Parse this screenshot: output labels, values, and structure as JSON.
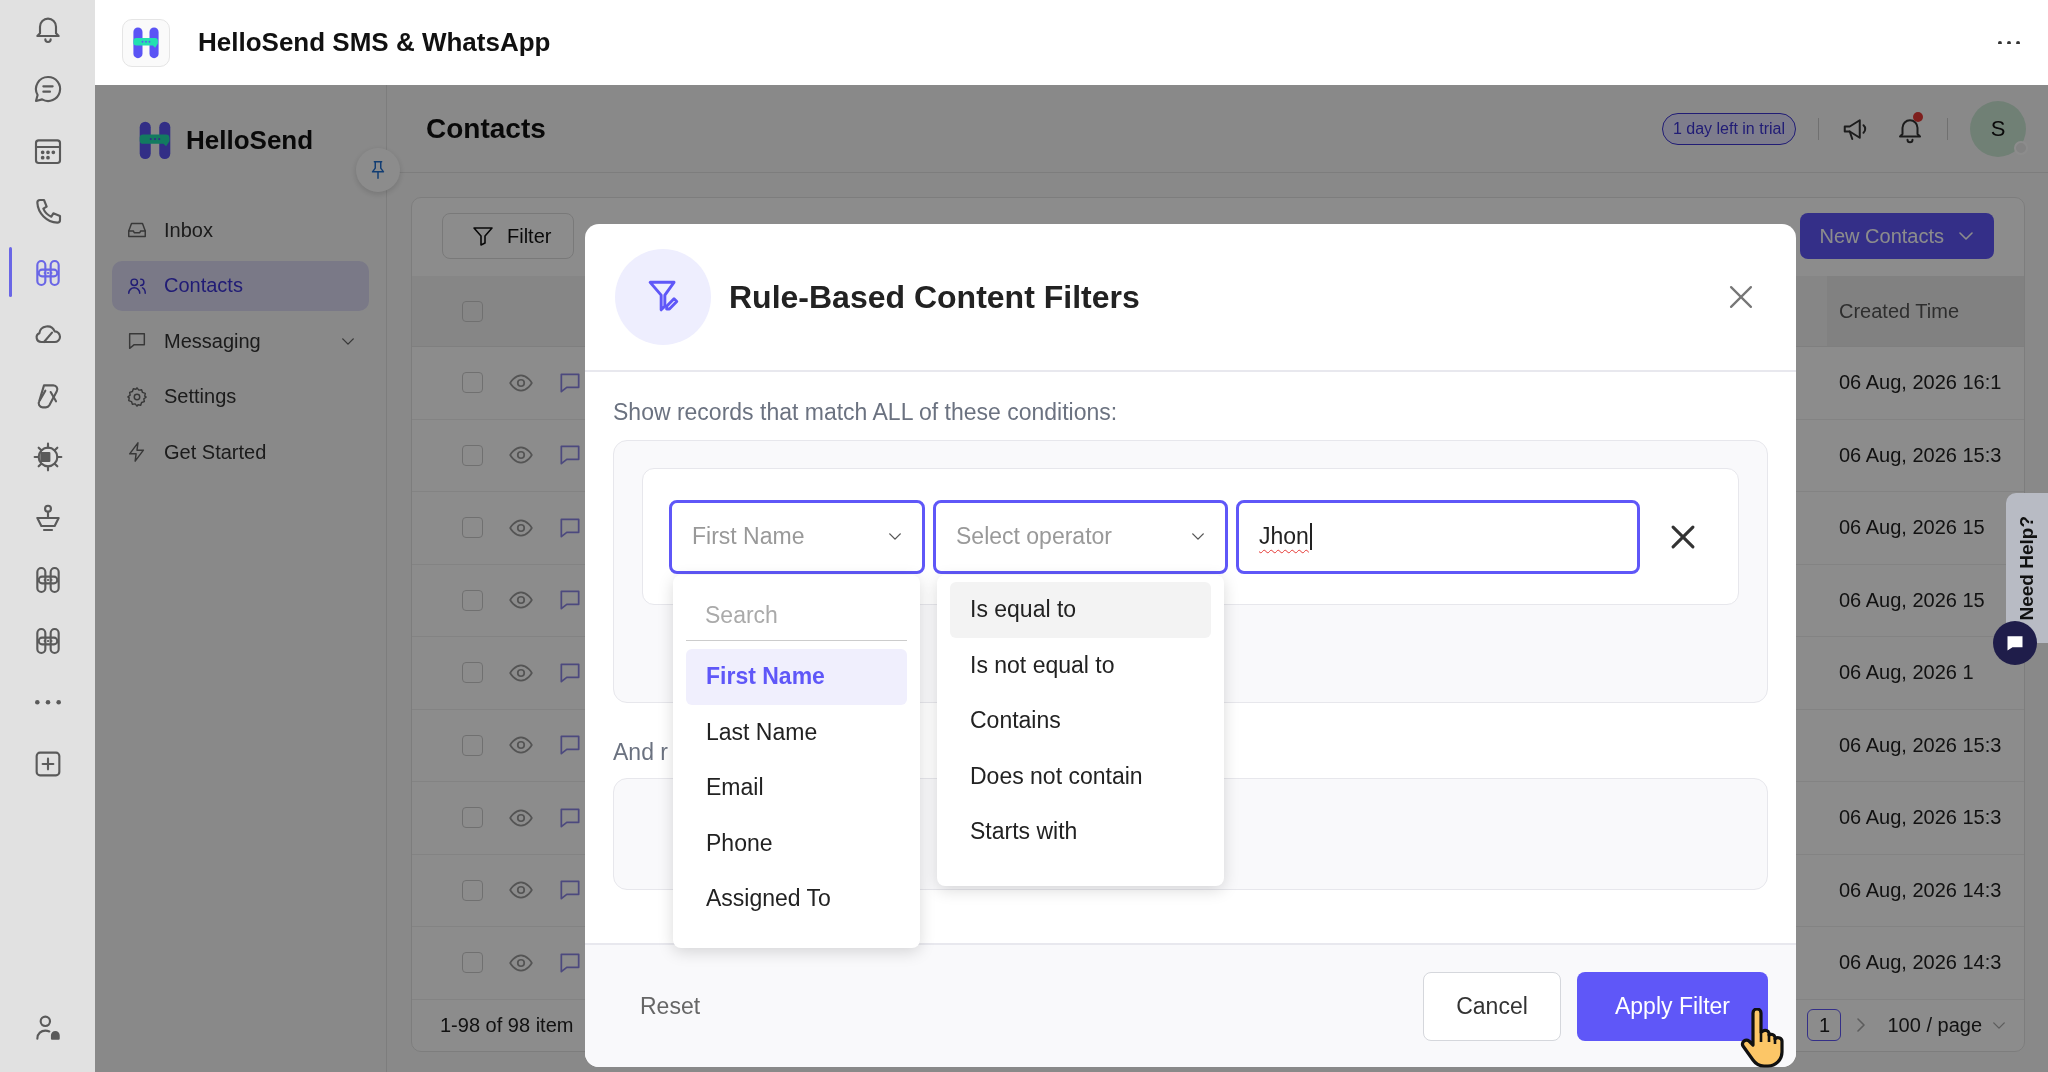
{
  "app_bar": {
    "title": "HelloSend SMS & WhatsApp"
  },
  "rail": {
    "items": [
      {
        "kind": "bell",
        "selected": false
      },
      {
        "kind": "chat",
        "selected": false
      },
      {
        "kind": "calendar",
        "selected": false
      },
      {
        "kind": "phone",
        "selected": false
      },
      {
        "kind": "app",
        "selected": true
      },
      {
        "kind": "cloud",
        "selected": false
      },
      {
        "kind": "loop",
        "selected": false
      },
      {
        "kind": "translate",
        "selected": false
      },
      {
        "kind": "figure",
        "selected": false
      },
      {
        "kind": "app",
        "selected": false
      },
      {
        "kind": "app",
        "selected": false
      },
      {
        "kind": "more",
        "selected": false
      },
      {
        "kind": "add",
        "selected": false
      }
    ]
  },
  "sidebar": {
    "brand": "HelloSend",
    "items": [
      {
        "label": "Inbox",
        "kind": "link",
        "selected": false
      },
      {
        "label": "Contacts",
        "kind": "link",
        "selected": true
      },
      {
        "label": "Messaging",
        "kind": "group",
        "selected": false
      },
      {
        "label": "Settings",
        "kind": "link",
        "selected": false
      },
      {
        "label": "Get Started",
        "kind": "link",
        "selected": false
      }
    ]
  },
  "header": {
    "title": "Contacts",
    "trial_badge": "1 day left in trial",
    "notifications_unread": true,
    "avatar": "S"
  },
  "toolbar": {
    "filter_button": "Filter",
    "new_button": "New Contacts"
  },
  "table": {
    "select_all_checked": false,
    "columns": [
      {
        "label": "Created Time"
      }
    ],
    "rows": [
      {
        "checked": false,
        "created_time": "06 Aug, 2026 16:1"
      },
      {
        "checked": false,
        "created_time": "06 Aug, 2026 15:3"
      },
      {
        "checked": false,
        "created_time": "06 Aug, 2026 15"
      },
      {
        "checked": false,
        "created_time": "06 Aug, 2026 15"
      },
      {
        "checked": false,
        "created_time": "06 Aug, 2026 1"
      },
      {
        "checked": false,
        "created_time": "06 Aug, 2026 15:3"
      },
      {
        "checked": false,
        "created_time": "06 Aug, 2026 15:3"
      },
      {
        "checked": false,
        "created_time": "06 Aug, 2026 14:3"
      },
      {
        "checked": false,
        "created_time": "06 Aug, 2026 14:3"
      }
    ],
    "pagination": {
      "summary": "1-98 of 98 item",
      "page": "1",
      "page_size": "100 / page"
    }
  },
  "help_tab": {
    "label": "Need Help?"
  },
  "modal": {
    "title": "Rule-Based Content Filters",
    "intro": "Show records that match ALL of these conditions:",
    "condition": {
      "field": "First Name",
      "operator_placeholder": "Select operator",
      "value": "Jhon"
    },
    "any_label": "And r",
    "field_menu": {
      "search_placeholder": "Search",
      "options": [
        {
          "label": "First Name",
          "selected": true
        },
        {
          "label": "Last Name",
          "selected": false
        },
        {
          "label": "Email",
          "selected": false
        },
        {
          "label": "Phone",
          "selected": false
        },
        {
          "label": "Assigned To",
          "selected": false
        }
      ]
    },
    "operator_menu": {
      "options": [
        {
          "label": "Is equal to",
          "highlighted": true
        },
        {
          "label": "Is not equal to",
          "highlighted": false
        },
        {
          "label": "Contains",
          "highlighted": false
        },
        {
          "label": "Does not contain",
          "highlighted": false
        },
        {
          "label": "Starts with",
          "highlighted": false
        }
      ]
    },
    "buttons": {
      "reset": "Reset",
      "cancel": "Cancel",
      "apply": "Apply Filter"
    }
  }
}
